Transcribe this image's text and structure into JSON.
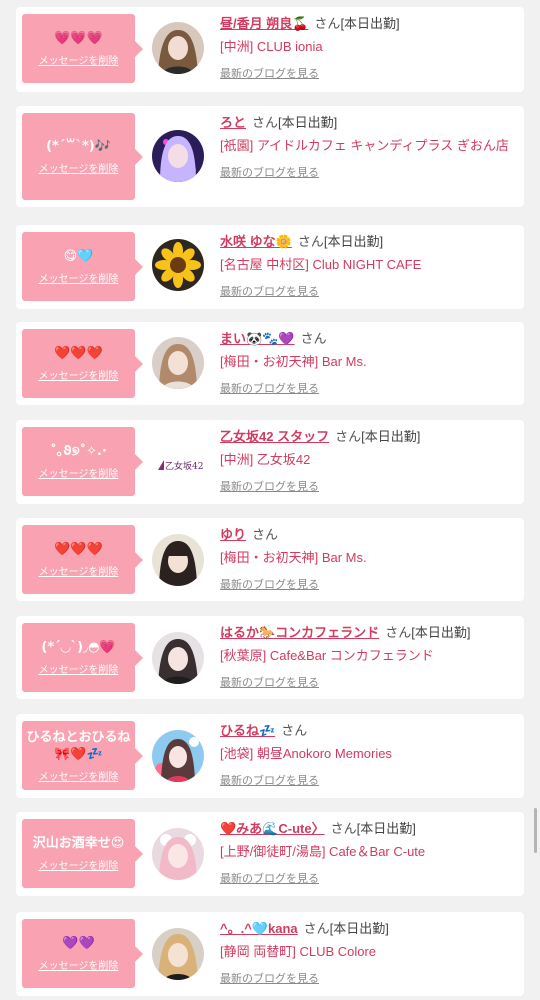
{
  "delete_label": "メッセージを削除",
  "blog_label": "最新のブログを見る",
  "san_label": "さん",
  "colors": {
    "bubble": "#f9a3b2",
    "name": "#d23b5f"
  },
  "items": [
    {
      "message": "💗💗💗",
      "name": "昼/香月 朔良🍒",
      "status": "[本日出勤]",
      "shop": "[中洲] CLUB ionia",
      "avatar": "portrait-woman"
    },
    {
      "message": "(*´꒳`*)🎶",
      "name": "ろと",
      "status": "[本日出勤]",
      "shop": "[祇園] アイドルカフェ キャンディプラス ぎおん店",
      "avatar": "portrait-purple-hair"
    },
    {
      "message": "😋🩵",
      "name": "水咲 ゆな🌼",
      "status": "[本日出勤]",
      "shop": "[名古屋 中村区] Club NIGHT CAFE",
      "avatar": "sunflower"
    },
    {
      "message": "❤️❤️❤️",
      "name": "まい🐼🐾💜",
      "status": "",
      "shop": "[梅田・お初天神] Bar Ms.",
      "avatar": "portrait-woman"
    },
    {
      "message": "˚｡ϑ୭˚✧.·",
      "name": "乙女坂42 スタッフ",
      "status": "[本日出勤]",
      "shop": "[中洲] 乙女坂42",
      "avatar": "logo",
      "logo_text": "乙女坂42"
    },
    {
      "message": "❤️❤️❤️",
      "name": "ゆり",
      "status": "",
      "shop": "[梅田・お初天神] Bar Ms.",
      "avatar": "portrait-woman"
    },
    {
      "message": "(*´◡`)◞◓💗",
      "name": "はるか🐎コンカフェランド",
      "status": "[本日出勤]",
      "shop": "[秋葉原] Cafe&Bar コンカフェランド",
      "avatar": "portrait-woman"
    },
    {
      "message": "ひるねとおひるね\n🎀❤️💤",
      "name": "ひるね💤",
      "status": "",
      "shop": "[池袋] 朝昼Anokoro Memories",
      "avatar": "portrait-blue"
    },
    {
      "message": "沢山お酒幸せ😍",
      "name": "❤️みあ🌊C-ute〉",
      "status": "[本日出勤]",
      "shop": "[上野/御徒町/湯島] Cafe＆Bar C-ute",
      "avatar": "portrait-pink"
    },
    {
      "message": "💜💜",
      "name": "^。.^🩵kana",
      "status": "[本日出勤]",
      "shop": "[静岡 両替町] CLUB Colore",
      "avatar": "portrait-blonde"
    }
  ]
}
